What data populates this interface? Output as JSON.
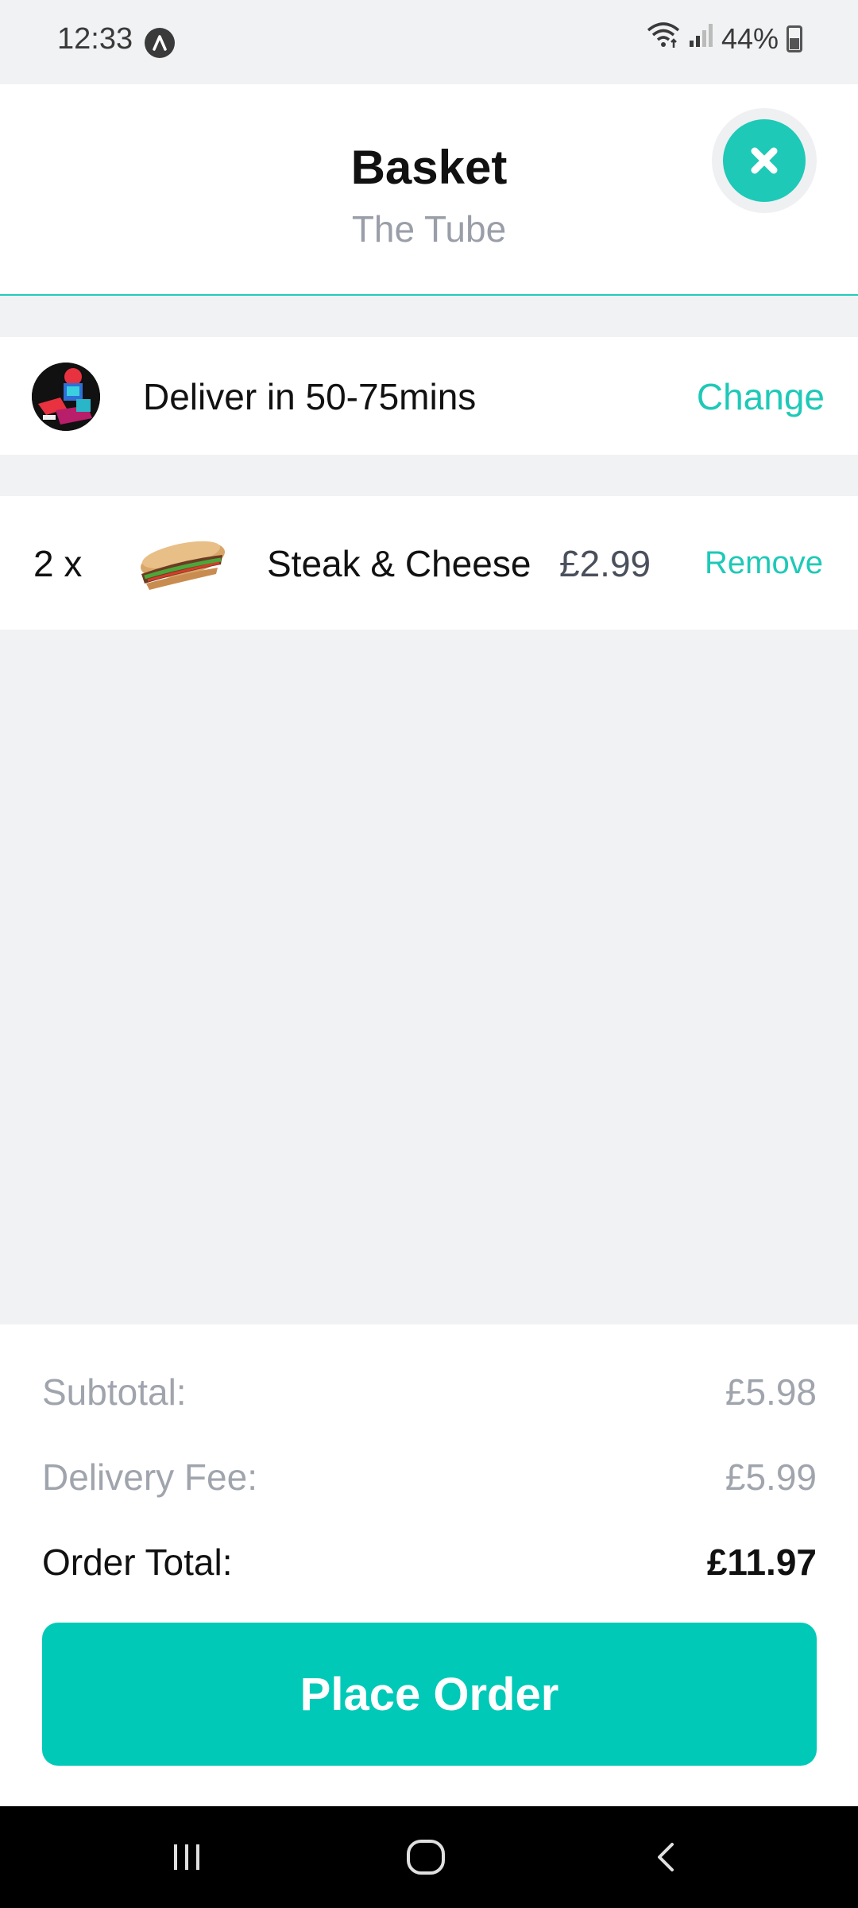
{
  "status_bar": {
    "time": "12:33",
    "battery": "44%"
  },
  "header": {
    "title": "Basket",
    "subtitle": "The Tube",
    "close_icon": "close-icon"
  },
  "delivery": {
    "text": "Deliver in 50-75mins",
    "change_label": "Change"
  },
  "basket": {
    "items": [
      {
        "quantity": "2 x",
        "name": "Steak & Cheese",
        "price": "£2.99",
        "remove_label": "Remove"
      }
    ]
  },
  "summary": {
    "subtotal_label": "Subtotal:",
    "subtotal_value": "£5.98",
    "delivery_fee_label": "Delivery Fee:",
    "delivery_fee_value": "£5.99",
    "order_total_label": "Order Total:",
    "order_total_value": "£11.97",
    "place_order_label": "Place Order"
  },
  "colors": {
    "accent": "#00c9b8",
    "muted_text": "#a0a4ad"
  }
}
